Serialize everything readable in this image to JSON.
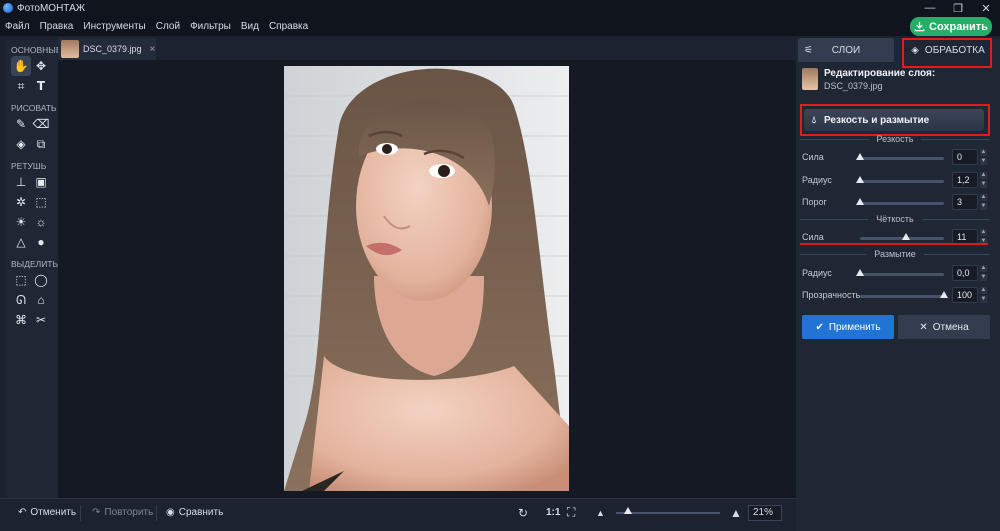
{
  "app": {
    "title": "ФотоМОНТАЖ"
  },
  "menu": [
    "Файл",
    "Правка",
    "Инструменты",
    "Слой",
    "Фильтры",
    "Вид",
    "Справка"
  ],
  "save_button": "Сохранить",
  "toolbox": {
    "sections": [
      "ОСНОВНЫЕ",
      "РИСОВАТЬ",
      "РЕТУШЬ",
      "ВЫДЕЛИТЬ"
    ]
  },
  "document_tab": {
    "name": "DSC_0379.jpg",
    "close": "×"
  },
  "bottom": {
    "undo": "Отменить",
    "redo": "Повторить",
    "compare": "Сравнить",
    "one_to_one": "1:1",
    "zoom": "21%",
    "zoom_fraction": 0.12
  },
  "right_panel": {
    "tab_layers": "СЛОИ",
    "tab_processing": "ОБРАБОТКА",
    "edit_title": "Редактирование слоя:",
    "edit_file": "DSC_0379.jpg",
    "filter_button": "Резкость и размытие",
    "groups": {
      "sharpness": "Резкость",
      "clarity": "Чёткость",
      "blur": "Размытие"
    },
    "params": {
      "sharp_strength": {
        "label": "Сила",
        "value": "0",
        "fraction": 0.0
      },
      "sharp_radius": {
        "label": "Радиус",
        "value": "1,2",
        "fraction": 0.0
      },
      "sharp_threshold": {
        "label": "Порог",
        "value": "3",
        "fraction": 0.0
      },
      "clarity_strength": {
        "label": "Сила",
        "value": "11",
        "fraction": 0.55
      },
      "blur_radius": {
        "label": "Радиус",
        "value": "0,0",
        "fraction": 0.0
      },
      "blur_opacity": {
        "label": "Прозрачность",
        "value": "100",
        "fraction": 1.0
      }
    },
    "apply": "Применить",
    "cancel": "Отмена"
  },
  "colors": {
    "accent_green": "#27ad68",
    "accent_blue": "#1f74d4",
    "highlight_red": "#e21c1c"
  }
}
